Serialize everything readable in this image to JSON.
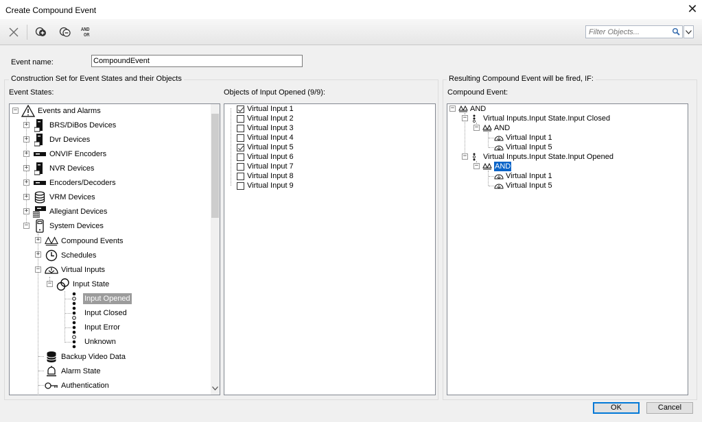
{
  "window": {
    "title": "Create Compound Event",
    "close_glyph": "✕"
  },
  "toolbar": {
    "icons": [
      "close-icon",
      "add-compound-icon",
      "remove-compound-icon",
      "and-or-icon"
    ],
    "and_top": "AND",
    "and_bottom": "OR",
    "filter_placeholder": "Filter Objects..."
  },
  "form": {
    "event_name_label": "Event name:",
    "event_name_value": "CompoundEvent"
  },
  "construction": {
    "group_title": "Construction Set for Event States and their Objects",
    "event_states_label": "Event States:",
    "tree": [
      {
        "label": "Events and Alarms",
        "icon": "alarm-triangle-icon"
      },
      {
        "label": "BRS/DiBos Devices",
        "icon": "server-icon"
      },
      {
        "label": "Dvr Devices",
        "icon": "server-icon"
      },
      {
        "label": "ONVIF Encoders",
        "icon": "encoder-icon"
      },
      {
        "label": "NVR Devices",
        "icon": "server-icon"
      },
      {
        "label": "Encoders/Decoders",
        "icon": "encoder-icon"
      },
      {
        "label": "VRM Devices",
        "icon": "database-icon"
      },
      {
        "label": "Allegiant Devices",
        "icon": "matrix-switch-icon"
      },
      {
        "label": "System Devices",
        "icon": "phone-device-icon"
      },
      {
        "label": "Compound Events",
        "icon": "compound-event-icon"
      },
      {
        "label": "Schedules",
        "icon": "clock-icon"
      },
      {
        "label": "Virtual Inputs",
        "icon": "virtual-input-icon"
      },
      {
        "label": "Input State",
        "icon": "link-icon"
      },
      {
        "label": "Input Opened",
        "icon": "state-dots-icon"
      },
      {
        "label": "Input Closed",
        "icon": "state-dots-icon"
      },
      {
        "label": "Input Error",
        "icon": "state-dots-icon"
      },
      {
        "label": "Unknown",
        "icon": "state-dots-icon"
      },
      {
        "label": "Backup Video Data",
        "icon": "database-icon"
      },
      {
        "label": "Alarm State",
        "icon": "bell-icon"
      },
      {
        "label": "Authentication",
        "icon": "key-icon"
      }
    ]
  },
  "objects": {
    "label": "Objects of Input Opened (9/9):",
    "items": [
      {
        "label": "Virtual Input 1",
        "checked": true
      },
      {
        "label": "Virtual Input 2",
        "checked": false
      },
      {
        "label": "Virtual Input 3",
        "checked": false
      },
      {
        "label": "Virtual Input 4",
        "checked": false
      },
      {
        "label": "Virtual Input 5",
        "checked": true
      },
      {
        "label": "Virtual Input 6",
        "checked": false
      },
      {
        "label": "Virtual Input 7",
        "checked": false
      },
      {
        "label": "Virtual Input 8",
        "checked": false
      },
      {
        "label": "Virtual Input 9",
        "checked": false
      }
    ]
  },
  "result": {
    "group_title": "Resulting Compound Event will be fired, IF:",
    "label": "Compound Event:",
    "tree": [
      {
        "label": "AND"
      },
      {
        "label": "Virtual Inputs.Input State.Input Closed"
      },
      {
        "label": "AND"
      },
      {
        "label": "Virtual Input 1"
      },
      {
        "label": "Virtual Input 5"
      },
      {
        "label": "Virtual Inputs.Input State.Input Opened"
      },
      {
        "label": "AND"
      },
      {
        "label": "Virtual Input 1"
      },
      {
        "label": "Virtual Input 5"
      }
    ]
  },
  "buttons": {
    "ok": "OK",
    "cancel": "Cancel"
  }
}
